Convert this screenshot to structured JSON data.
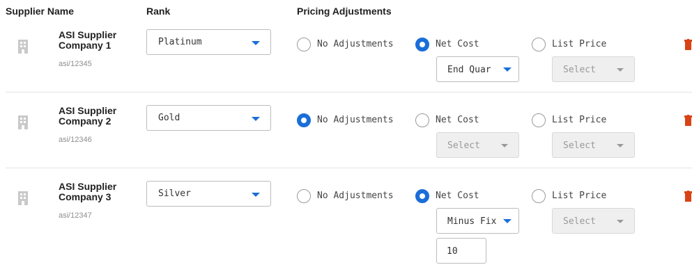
{
  "header": {
    "supplier_name": "Supplier Name",
    "rank": "Rank",
    "pricing_adjustments": "Pricing Adjustments"
  },
  "radio_labels": {
    "no_adjustments": "No Adjustments",
    "net_cost": "Net Cost",
    "list_price": "List Price"
  },
  "colors": {
    "accent": "#1a6ed8",
    "delete": "#d84315"
  },
  "rows": [
    {
      "name": "ASI Supplier Company 1",
      "id": "asi/12345",
      "rank": "Platinum",
      "selected_adjustment": "net_cost",
      "net_cost_select": "End Quar",
      "list_price_select": "Select"
    },
    {
      "name": "ASI Supplier Company 2",
      "id": "asi/12346",
      "rank": "Gold",
      "selected_adjustment": "no_adjustments",
      "net_cost_select": "Select",
      "list_price_select": "Select"
    },
    {
      "name": "ASI Supplier Company 3",
      "id": "asi/12347",
      "rank": "Silver",
      "selected_adjustment": "net_cost",
      "net_cost_select": "Minus Fix",
      "list_price_select": "Select",
      "net_cost_value": "10"
    }
  ]
}
